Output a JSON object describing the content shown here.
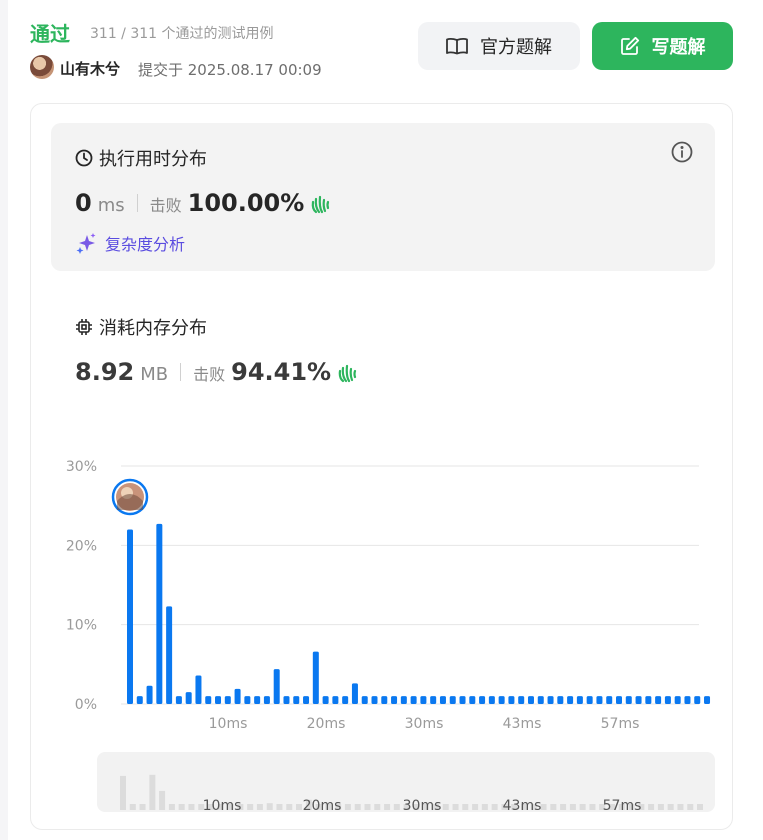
{
  "header": {
    "status": "通过",
    "cases": "311 / 311 个通过的测试用例",
    "user": "山有木兮",
    "submitted": "提交于 2025.08.17 00:09",
    "official_solution_label": "官方题解",
    "write_solution_label": "写题解"
  },
  "runtime": {
    "title": "执行用时分布",
    "value": "0",
    "unit": "ms",
    "beats_label": "击败",
    "beats": "100.00%",
    "complexity_label": "复杂度分析"
  },
  "memory": {
    "title": "消耗内存分布",
    "value": "8.92",
    "unit": "MB",
    "beats_label": "击败",
    "beats": "94.41%"
  },
  "colors": {
    "accent_green": "#2db55d",
    "bar_blue": "#0a78f0",
    "complexity_purple": "#5a4ce0"
  },
  "chart_data": {
    "type": "bar",
    "ylim": [
      0,
      30
    ],
    "y_ticks": [
      "0%",
      "10%",
      "20%",
      "30%"
    ],
    "x_ticks": [
      "10ms",
      "20ms",
      "30ms",
      "43ms",
      "57ms"
    ],
    "grid": true,
    "values": [
      22,
      1,
      2.3,
      22.7,
      12.3,
      1,
      1.5,
      3.6,
      1,
      1,
      1,
      1.9,
      1,
      1,
      1,
      4.4,
      1,
      1,
      1,
      6.6,
      1,
      1,
      1,
      2.6,
      1,
      1,
      1,
      1,
      1,
      1,
      1,
      1,
      1,
      1,
      1,
      1,
      1,
      1,
      1,
      1,
      1,
      1,
      1,
      1,
      1,
      1,
      1,
      1,
      1,
      1,
      1,
      1,
      1,
      1,
      1,
      1,
      1,
      1,
      1,
      1
    ],
    "highlight_index": 0,
    "overview_x_ticks": [
      "10ms",
      "20ms",
      "30ms",
      "43ms",
      "57ms"
    ]
  }
}
